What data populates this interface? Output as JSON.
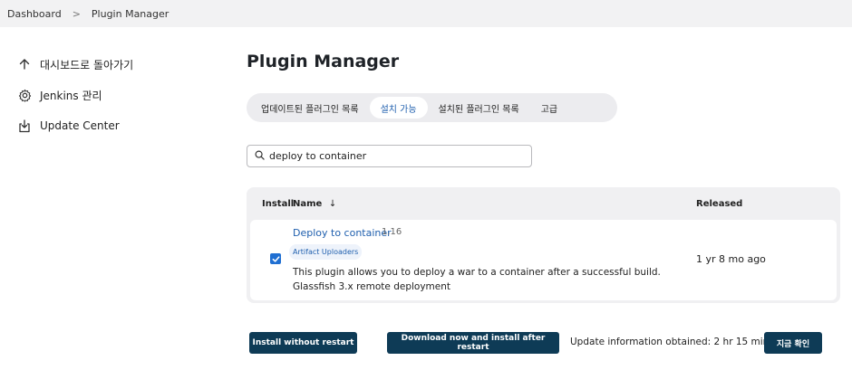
{
  "breadcrumb": {
    "items": [
      "Dashboard",
      "Plugin Manager"
    ],
    "separator": ">"
  },
  "sidebar": {
    "items": [
      {
        "label": "대시보드로 돌아가기",
        "icon": "arrow-up-icon"
      },
      {
        "label": "Jenkins 관리",
        "icon": "gear-icon"
      },
      {
        "label": "Update Center",
        "icon": "download-box-icon"
      }
    ]
  },
  "page": {
    "title": "Plugin Manager"
  },
  "tabs": [
    {
      "label": "업데이트된 플러그인 목록",
      "active": false
    },
    {
      "label": "설치 가능",
      "active": true
    },
    {
      "label": "설치된 플러그인 목록",
      "active": false
    },
    {
      "label": "고급",
      "active": false
    }
  ],
  "search": {
    "value": "deploy to container",
    "icon": "search-icon"
  },
  "table": {
    "headers": {
      "install": "Install",
      "name": "Name",
      "sort_indicator": "↓",
      "released": "Released"
    },
    "rows": [
      {
        "checked": true,
        "name": "Deploy to container",
        "version": "1.16",
        "tag": "Artifact Uploaders",
        "description_line1": "This plugin allows you to deploy a war to a container after a successful build.",
        "description_line2": "Glassfish 3.x remote deployment",
        "released": "1 yr 8 mo ago"
      }
    ]
  },
  "footer": {
    "install_label": "Install without restart",
    "download_label": "Download now and install after restart",
    "update_info": "Update information obtained: 2 hr 15 min ago",
    "check_now_label": "지금 확인"
  },
  "colors": {
    "accent": "#1f5fae",
    "button": "#0e3b56",
    "checkbox": "#1f6fd2"
  }
}
